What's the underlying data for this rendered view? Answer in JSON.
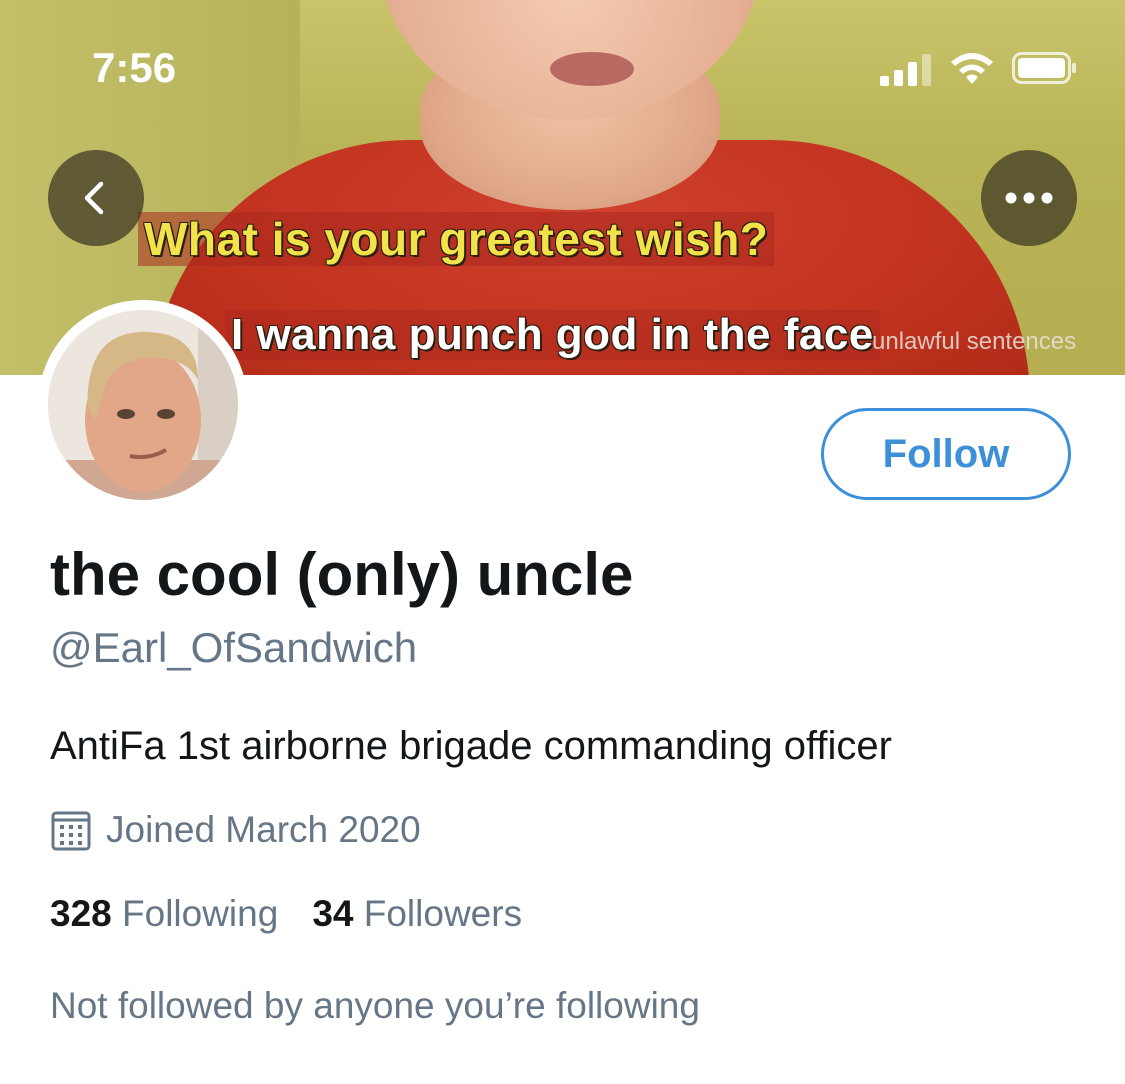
{
  "status_bar": {
    "time": "7:56"
  },
  "banner": {
    "caption_top": "What is your greatest wish?",
    "caption_bottom": "I wanna punch god in the face",
    "watermark": "unlawful sentences"
  },
  "profile": {
    "follow_label": "Follow",
    "display_name": "the cool (only) uncle",
    "handle": "@Earl_OfSandwich",
    "bio": "AntiFa 1st airborne brigade commanding officer",
    "joined": "Joined March 2020",
    "following_count": "328",
    "following_label": "Following",
    "followers_count": "34",
    "followers_label": "Followers",
    "not_followed_text": "Not followed by anyone you’re following"
  },
  "colors": {
    "accent": "#3c8fd9",
    "secondary_text": "#657786",
    "primary_text": "#14171a"
  },
  "icons": {
    "back": "chevron-left-icon",
    "more": "more-horizontal-icon",
    "calendar": "calendar-icon"
  }
}
